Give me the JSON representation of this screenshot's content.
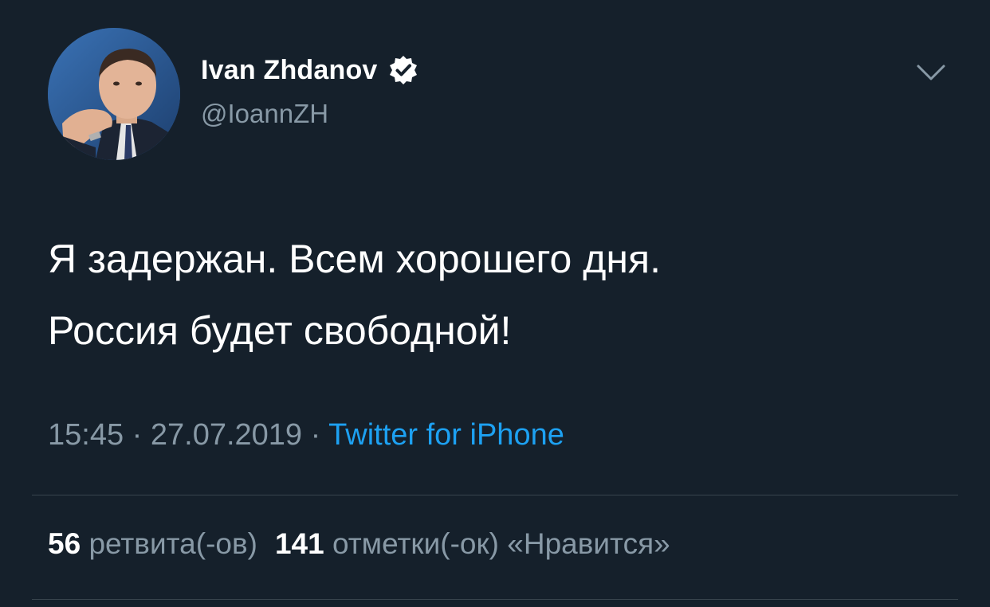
{
  "tweet": {
    "author": {
      "display_name": "Ivan Zhdanov",
      "handle": "@IoannZH",
      "verified": true,
      "avatar": "profile-photo"
    },
    "text_lines": [
      "Я задержан. Всем хорошего дня.",
      "Россия будет свободной!"
    ],
    "meta": {
      "time": "15:45",
      "separator": "·",
      "date": "27.07.2019",
      "source": "Twitter for iPhone"
    },
    "stats": {
      "retweets_count": "56",
      "retweets_label": "ретвита(-ов)",
      "likes_count": "141",
      "likes_label": "отметки(-ок) «Нравится»"
    },
    "menu_icon": "chevron-down-icon"
  },
  "colors": {
    "background": "#15202b",
    "primary_text": "#ffffff",
    "secondary_text": "#8899a6",
    "link": "#1da1f2",
    "divider": "#38444d"
  }
}
